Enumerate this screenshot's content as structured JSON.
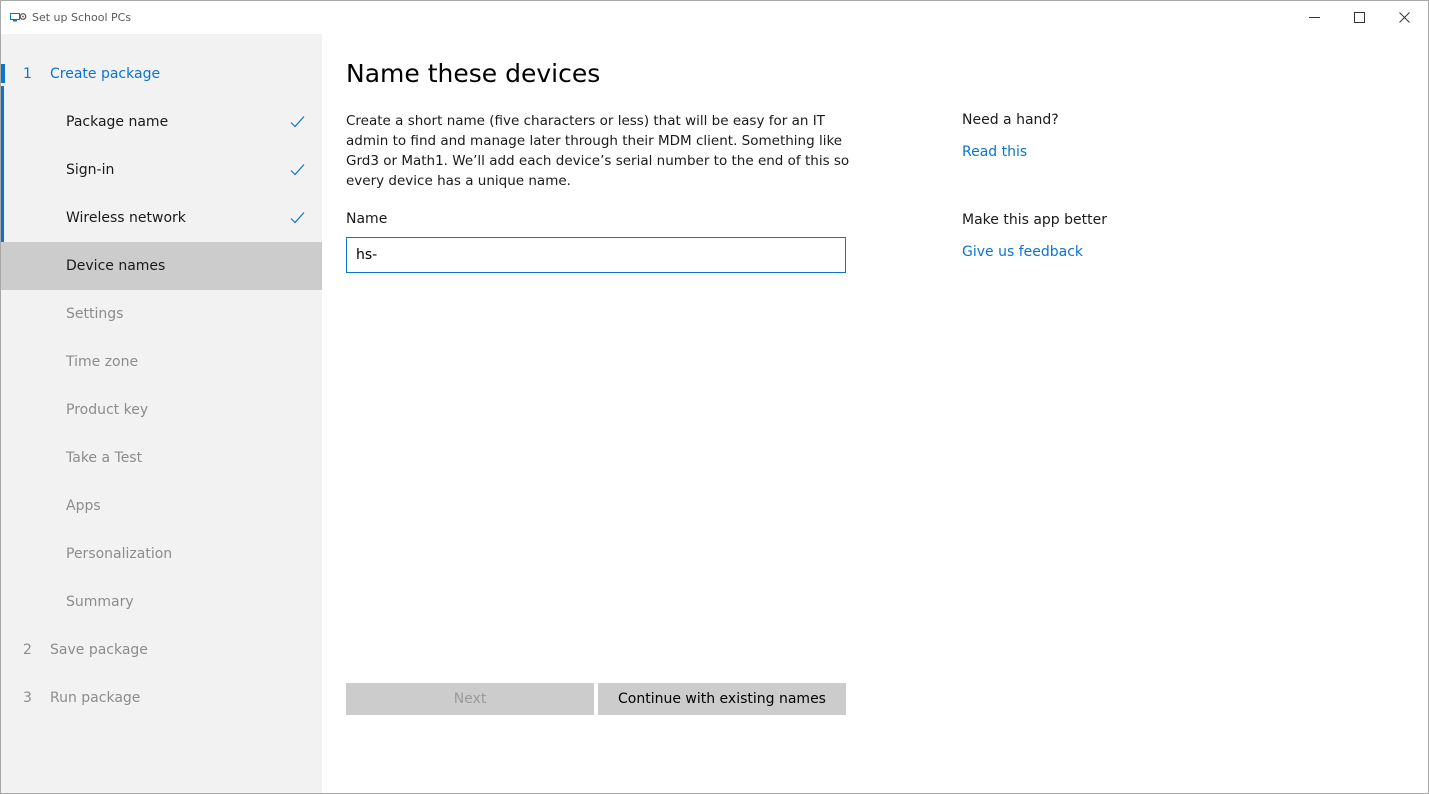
{
  "window": {
    "title": "Set up School PCs"
  },
  "sidebar": {
    "steps": [
      {
        "number": "1",
        "label": "Create package",
        "state": "active"
      },
      {
        "number": "2",
        "label": "Save package",
        "state": "future"
      },
      {
        "number": "3",
        "label": "Run package",
        "state": "future"
      }
    ],
    "substeps": [
      {
        "label": "Package name",
        "state": "done"
      },
      {
        "label": "Sign-in",
        "state": "done"
      },
      {
        "label": "Wireless network",
        "state": "done"
      },
      {
        "label": "Device names",
        "state": "current"
      },
      {
        "label": "Settings",
        "state": "future"
      },
      {
        "label": "Time zone",
        "state": "future"
      },
      {
        "label": "Product key",
        "state": "future"
      },
      {
        "label": "Take a Test",
        "state": "future"
      },
      {
        "label": "Apps",
        "state": "future"
      },
      {
        "label": "Personalization",
        "state": "future"
      },
      {
        "label": "Summary",
        "state": "future"
      }
    ]
  },
  "main": {
    "title": "Name these devices",
    "description": "Create a short name (five characters or less) that will be easy for an IT admin to find and manage later through their MDM client. Something like Grd3 or Math1. We’ll add each device’s serial number to the end of this so every device has a unique name.",
    "name_label": "Name",
    "name_value": "hs-",
    "next_label": "Next",
    "continue_label": "Continue with existing names"
  },
  "help": {
    "need_hand": "Need a hand?",
    "read_this": "Read this",
    "make_better": "Make this app better",
    "feedback": "Give us feedback"
  },
  "colors": {
    "accent": "#0a74cf",
    "sidebar_bg": "#f2f2f2",
    "selected_bg": "#cccccc"
  }
}
